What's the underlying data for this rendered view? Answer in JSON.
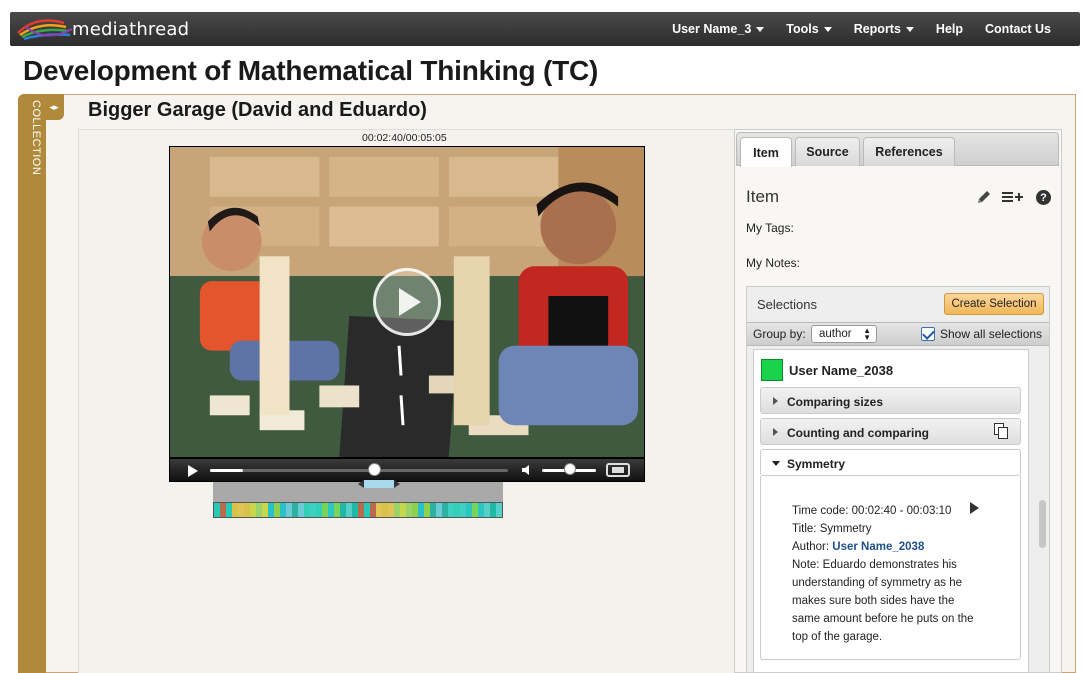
{
  "app": {
    "name": "mediathread"
  },
  "nav": {
    "items": [
      {
        "label": "User Name_3",
        "has_caret": true
      },
      {
        "label": "Tools",
        "has_caret": true
      },
      {
        "label": "Reports",
        "has_caret": true
      },
      {
        "label": "Help",
        "has_caret": false
      },
      {
        "label": "Contact Us",
        "has_caret": false
      }
    ]
  },
  "course": {
    "title": "Development of Mathematical Thinking (TC)"
  },
  "collection": {
    "label": "COLLECTION"
  },
  "item": {
    "title": "Bigger Garage (David and Eduardo)",
    "timecode": "00:02:40/00:05:05",
    "progress": 0.55,
    "volume": 0.4
  },
  "panel": {
    "tabs": [
      "Item",
      "Source",
      "References"
    ],
    "active_tab": "Item",
    "heading": "Item",
    "tags_label": "My Tags:",
    "notes_label": "My Notes:",
    "selections_label": "Selections",
    "create_selection": "Create Selection",
    "group_by_label": "Group by:",
    "group_by_value": "author",
    "show_all_label": "Show all selections",
    "show_all_checked": true,
    "user": {
      "name": "User Name_2038",
      "color": "#1ad34a"
    },
    "selections": [
      {
        "label": "Comparing sizes",
        "open": false
      },
      {
        "label": "Counting and comparing",
        "open": false
      },
      {
        "label": "Symmetry",
        "open": true
      }
    ],
    "detail": {
      "time_code": "Time code: 00:02:40 - 00:03:10",
      "title": "Title: Symmetry",
      "author_prefix": "Author:",
      "author": "User Name_2038",
      "note_lines": [
        "Note: Eduardo demonstrates his",
        "understanding of symmetry as he",
        "makes sure both sides have the",
        "same amount before he puts on the",
        "top of the garage."
      ]
    }
  },
  "icons": [
    "logo-icon",
    "caret-down-icon",
    "play-icon",
    "volume-icon",
    "fullscreen-icon",
    "pencil-icon",
    "list-add-icon",
    "help-icon",
    "copy-icon",
    "chevron-right-icon",
    "chevron-down-icon",
    "checkbox-icon"
  ],
  "colors": {
    "collection_accent": "#b08a3a",
    "create_button": "#f0b75a",
    "link": "#1f4e8c",
    "user_swatch": "#1ad34a"
  }
}
